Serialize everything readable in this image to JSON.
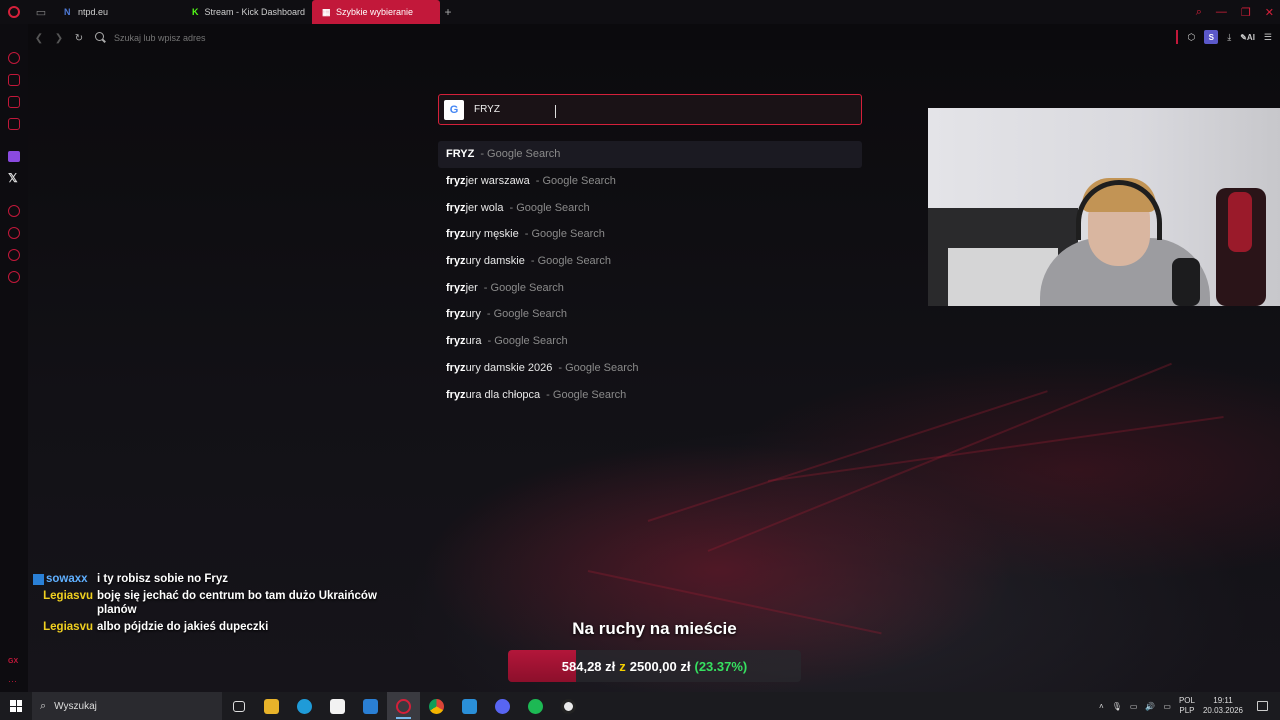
{
  "tabs": [
    {
      "title": "ntpd.eu",
      "favicon": "n-icon",
      "color": "#4f7bd8"
    },
    {
      "title": "Stream - Kick Dashboard",
      "favicon": "kick-icon",
      "color": "#53fc18"
    },
    {
      "title": "Szybkie wybieranie",
      "favicon": "grid-icon",
      "color": "#ffffff"
    }
  ],
  "address_bar": {
    "placeholder": "Szukaj lub wpisz adres"
  },
  "search": {
    "engine": "G",
    "value": "FRYZ"
  },
  "suggestions": [
    {
      "bold": "FRYZ",
      "rest": "",
      "suffix": "- Google Search"
    },
    {
      "bold": "fryz",
      "rest": "jer warszawa",
      "suffix": "- Google Search"
    },
    {
      "bold": "fryz",
      "rest": "jer wola",
      "suffix": "- Google Search"
    },
    {
      "bold": "fryz",
      "rest": "ury męskie",
      "suffix": "- Google Search"
    },
    {
      "bold": "fryz",
      "rest": "ury damskie",
      "suffix": "- Google Search"
    },
    {
      "bold": "fryz",
      "rest": "jer",
      "suffix": "- Google Search"
    },
    {
      "bold": "fryz",
      "rest": "ury",
      "suffix": "- Google Search"
    },
    {
      "bold": "fryz",
      "rest": "ura",
      "suffix": "- Google Search"
    },
    {
      "bold": "fryz",
      "rest": "ury damskie 2026",
      "suffix": "- Google Search"
    },
    {
      "bold": "fryz",
      "rest": "ura dla chłopca",
      "suffix": "- Google Search"
    }
  ],
  "extensions": {
    "s_badge": "S",
    "ai_label": "AI"
  },
  "chat": [
    {
      "user": "sowaxx",
      "message": "i ty robisz sobie no Fryz"
    },
    {
      "user": "Legiasvu",
      "message": "boję się jechać do centrum bo tam dużo Ukraińców planów"
    },
    {
      "user": "Legiasvu",
      "message": "albo pójdzie do jakieś dupeczki"
    }
  ],
  "goal": {
    "title": "Na ruchy na mieście",
    "current": "584,28 zł",
    "connector": "z",
    "target": "2500,00 zł",
    "percent_label": "(23.37%)",
    "progress": 0.2337
  },
  "sidebar": {
    "gx_label": "GX",
    "more_label": "···"
  },
  "taskbar": {
    "search_placeholder": "Wyszukaj",
    "lang_top": "POL",
    "lang_bottom": "PLP",
    "time": "19:11",
    "date": "20.03.2026"
  },
  "colors": {
    "accent": "#d4203a",
    "goal_fill": "#b3163a",
    "chat_yellow": "#f0d020",
    "chat_blue": "#5fb0ff"
  }
}
